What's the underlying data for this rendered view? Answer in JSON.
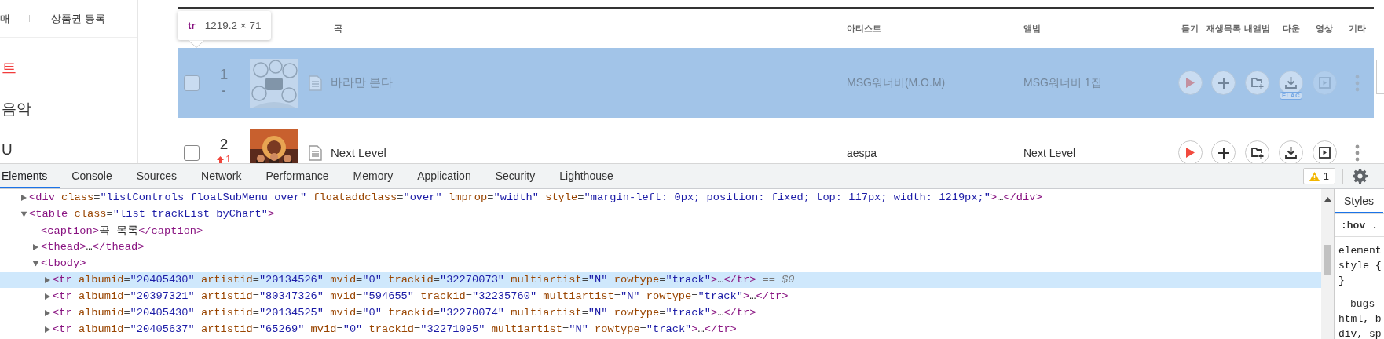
{
  "sidebar": {
    "top_links": [
      {
        "label": "매"
      },
      {
        "label": "상품권 등록"
      }
    ],
    "menu": [
      {
        "label": "트",
        "selected": true
      },
      {
        "label": "음악",
        "selected": false
      },
      {
        "label": "U",
        "selected": false
      }
    ]
  },
  "element_tooltip": {
    "tag": "tr",
    "size": "1219.2 × 71"
  },
  "track_table": {
    "columns": [
      "곡",
      "아티스트",
      "앨범",
      "듣기",
      "재생목록",
      "내앨범",
      "다운",
      "영상",
      "기타"
    ],
    "rows": [
      {
        "selected": true,
        "checked": false,
        "rank": "1",
        "change": "-",
        "rank_up": false,
        "title": "바라만 본다",
        "artist": "MSG워너비(M.O.M)",
        "album": "MSG워너비 1집",
        "badge": "FLAC",
        "video_disabled": true
      },
      {
        "selected": false,
        "checked": false,
        "rank": "2",
        "change": "1",
        "rank_up": true,
        "title": "Next Level",
        "artist": "aespa",
        "album": "Next Level",
        "video_disabled": false
      }
    ]
  },
  "devtools": {
    "tabs": [
      {
        "label": "Elements",
        "selected": true
      },
      {
        "label": "Console",
        "selected": false
      },
      {
        "label": "Sources",
        "selected": false
      },
      {
        "label": "Network",
        "selected": false
      },
      {
        "label": "Performance",
        "selected": false
      },
      {
        "label": "Memory",
        "selected": false
      },
      {
        "label": "Application",
        "selected": false
      },
      {
        "label": "Security",
        "selected": false
      },
      {
        "label": "Lighthouse",
        "selected": false
      }
    ],
    "warning_count": "1",
    "dom_tree": [
      {
        "markup": "<div class=\"listControls floatSubMenu over\" floataddclass=\"over\" lmprop=\"width\" style=\"margin-left: 0px; position: fixed; top: 117px; width: 1219px;\">…</div>",
        "expandable": true,
        "expanded": false,
        "selected": false
      },
      {
        "markup": "<table class=\"list trackList byChart\">",
        "expandable": true,
        "expanded": true,
        "selected": false,
        "children": [
          {
            "markup": "<caption>곡 목록</caption>",
            "expandable": false,
            "selected": false
          },
          {
            "markup": "<thead>…</thead>",
            "expandable": true,
            "expanded": false,
            "selected": false
          },
          {
            "markup": "<tbody>",
            "expandable": true,
            "expanded": true,
            "selected": false,
            "children": [
              {
                "markup": "<tr albumid=\"20405430\" artistid=\"20134526\" mvid=\"0\" trackid=\"32270073\" multiartist=\"N\" rowtype=\"track\">…</tr>",
                "expandable": true,
                "expanded": false,
                "selected": true,
                "console_ref": "== $0"
              },
              {
                "markup": "<tr albumid=\"20397321\" artistid=\"80347326\" mvid=\"594655\" trackid=\"32235760\" multiartist=\"N\" rowtype=\"track\">…</tr>",
                "expandable": true,
                "expanded": false,
                "selected": false
              },
              {
                "markup": "<tr albumid=\"20405430\" artistid=\"20134525\" mvid=\"0\" trackid=\"32270074\" multiartist=\"N\" rowtype=\"track\">…</tr>",
                "expandable": true,
                "expanded": false,
                "selected": false
              },
              {
                "markup": "<tr albumid=\"20405637\" artistid=\"65269\" mvid=\"0\" trackid=\"32271095\" multiartist=\"N\" rowtype=\"track\">…</tr>",
                "expandable": true,
                "expanded": false,
                "selected": false
              }
            ]
          }
        ]
      }
    ],
    "styles_panel": {
      "tab": "Styles",
      "filters": [
        ":hov",
        "."
      ],
      "lines": [
        {
          "text": "element",
          "kind": "selector"
        },
        {
          "text": "style {",
          "kind": "selector"
        },
        {
          "text": "}",
          "kind": "brace"
        },
        {
          "text": "bugs_",
          "kind": "source_link"
        },
        {
          "text": "html, b",
          "kind": "selector"
        },
        {
          "text": "div, sp",
          "kind": "selector"
        }
      ]
    }
  }
}
